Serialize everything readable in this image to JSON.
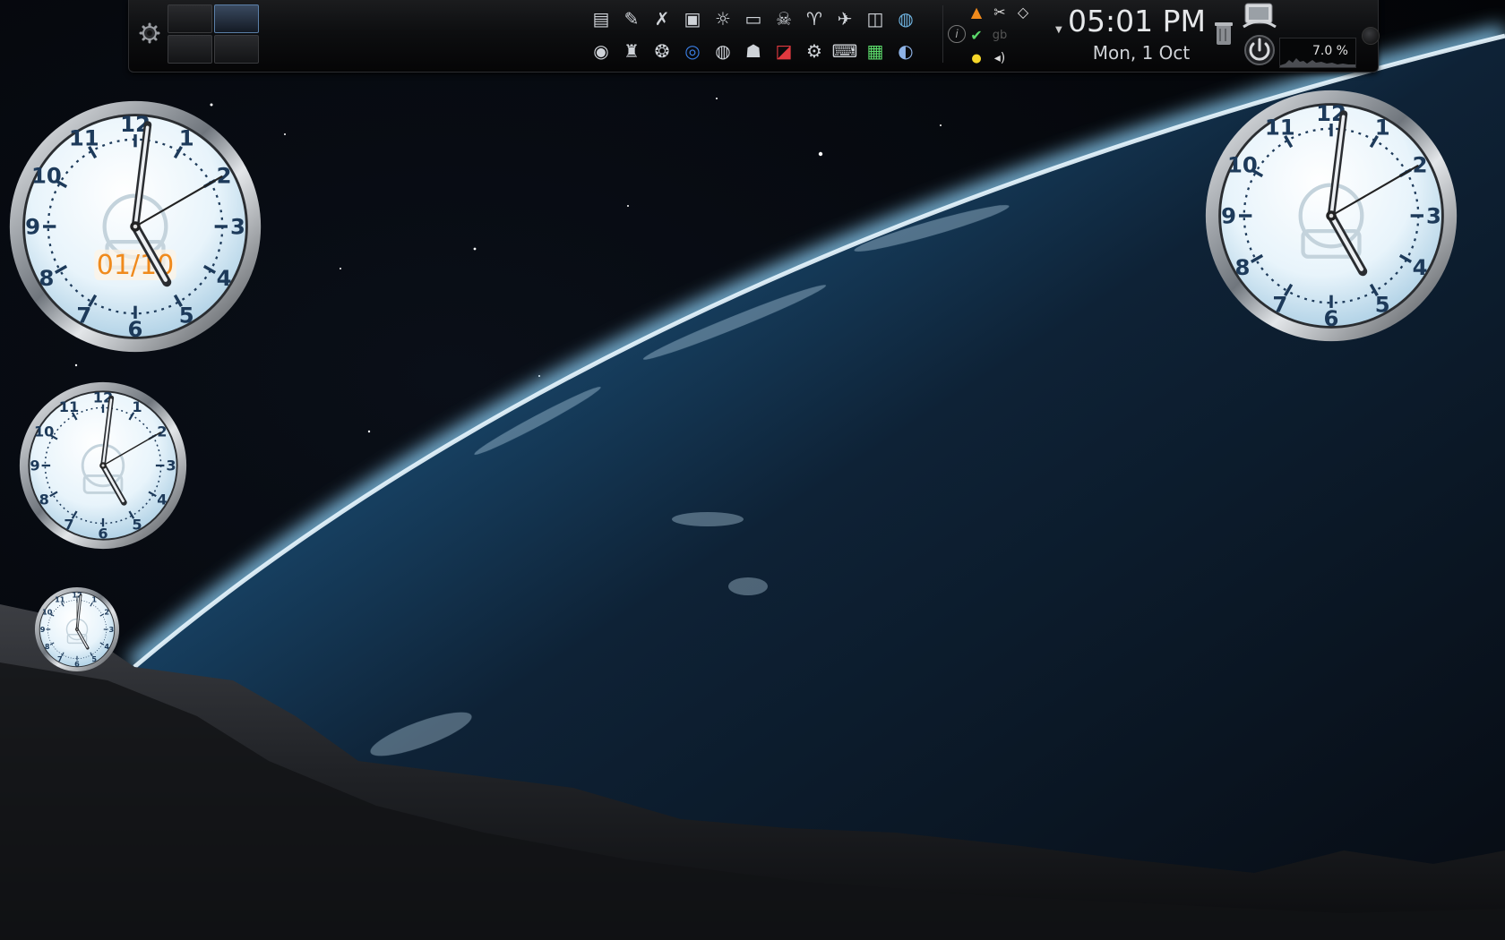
{
  "panel": {
    "launchers_row1": [
      "printer-icon",
      "pencil-icon",
      "tools-icon",
      "monitor-icon",
      "sun-settings-icon",
      "folder-icon",
      "skull-icon",
      "tshirt-icon",
      "satellite-icon",
      "window-icon",
      "globe-icon"
    ],
    "launchers_row2": [
      "disc-icon",
      "bust-icon",
      "mask-icon",
      "mc-icon",
      "speaker-icon",
      "helmet-icon",
      "flag-icon",
      "robot-icon",
      "typewriter-icon",
      "sysmon-icon",
      "world-map-icon"
    ],
    "tray_icons": [
      "vlc-icon",
      "scissors-icon",
      "eraser-icon",
      "check-icon",
      "gb-icon",
      "sun-icon",
      "volume-icon"
    ],
    "tray_gb_text": "gb",
    "clock": {
      "time": "05:01 PM",
      "date": "Mon, 1 Oct"
    },
    "cpu": {
      "label": "7.0 %",
      "percent": 7.0
    },
    "info_glyph": "i"
  },
  "desktop_clocks": [
    {
      "id": "large-clock-left",
      "hour": 5,
      "minute": 1,
      "second": 10,
      "date_label": "01/10"
    },
    {
      "id": "medium-clock-left",
      "hour": 5,
      "minute": 1,
      "second": 10
    },
    {
      "id": "small-clock-left",
      "hour": 5,
      "minute": 1,
      "second": 0
    },
    {
      "id": "large-clock-right",
      "hour": 5,
      "minute": 1,
      "second": 10
    }
  ],
  "clock_numerals": [
    "12",
    "1",
    "2",
    "3",
    "4",
    "5",
    "6",
    "7",
    "8",
    "9",
    "10",
    "11"
  ],
  "colors": {
    "clock_face": "#e8f4fb",
    "clock_numeral": "#1d3a5a",
    "date_label": "#f08a1c",
    "earth_blue": "#2a7fbf"
  }
}
